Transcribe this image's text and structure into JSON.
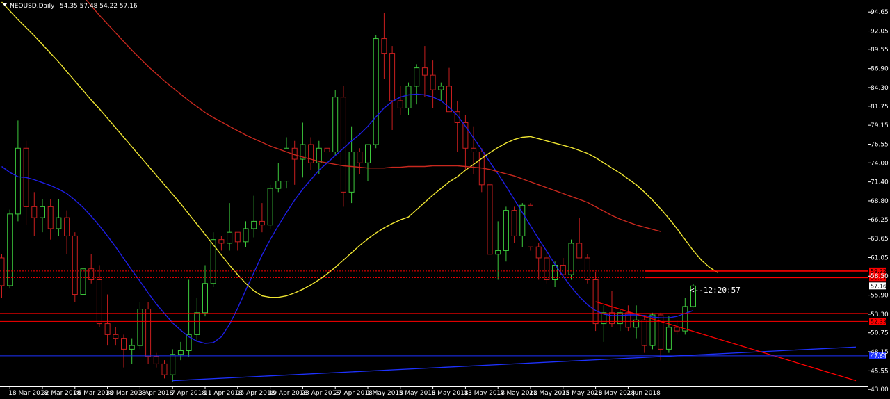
{
  "header": {
    "symbol": "NEOUSD,Daily",
    "ohlc": "54.35 57.48 54.22 57.16"
  },
  "countdown": "<--12:20:57",
  "colors": {
    "background": "#000000",
    "bull": "#3cc83c",
    "bear": "#c81e1e",
    "ma_fast": "#1e1ee6",
    "ma_mid": "#f0e632",
    "ma_slow": "#c8281e",
    "level": "#ff0000",
    "trend_support": "#1e32ff",
    "trend_resistance": "#ff0000",
    "price_box_text": "#000000",
    "axis_text": "#ffffff"
  },
  "chart_data": {
    "type": "candlestick",
    "ylim": [
      43.4,
      96.0
    ],
    "y_ticks": [
      "94.65",
      "92.05",
      "89.55",
      "86.90",
      "84.30",
      "81.75",
      "79.15",
      "76.55",
      "74.00",
      "71.40",
      "68.80",
      "66.25",
      "63.65",
      "61.05",
      "58.50",
      "55.90",
      "53.30",
      "50.75",
      "48.15",
      "45.55",
      "43.00"
    ],
    "x_ticks": [
      "18 Mar 2018",
      "22 Mar 2018",
      "26 Mar 2018",
      "30 Mar 2018",
      "3 Apr 2018",
      "7 Apr 2018",
      "11 Apr 2018",
      "15 Apr 2018",
      "19 Apr 2018",
      "23 Apr 2018",
      "27 Apr 2018",
      "1 May 2018",
      "5 May 2018",
      "9 May 2018",
      "13 May 2018",
      "17 May 2018",
      "21 May 2018",
      "25 May 2018",
      "29 May 2018",
      "2 Jun 2018"
    ],
    "first_date": "17 Mar 2018",
    "last_price": 57.16,
    "candles": [
      [
        61.0,
        61.5,
        55.5,
        57.2
      ],
      [
        57.2,
        67.6,
        56.8,
        67.0
      ],
      [
        67.0,
        79.8,
        66.0,
        76.0
      ],
      [
        76.0,
        77.0,
        65.5,
        68.0
      ],
      [
        68.0,
        70.0,
        64.0,
        66.5
      ],
      [
        66.5,
        69.0,
        64.5,
        68.0
      ],
      [
        68.0,
        69.0,
        63.5,
        65.0
      ],
      [
        65.0,
        69.0,
        64.0,
        66.5
      ],
      [
        66.5,
        67.5,
        61.5,
        64.0
      ],
      [
        64.0,
        64.5,
        55.0,
        56.0
      ],
      [
        56.0,
        61.5,
        52.0,
        59.5
      ],
      [
        59.5,
        61.5,
        57.5,
        58.0
      ],
      [
        58.0,
        60.0,
        51.5,
        52.0
      ],
      [
        52.0,
        56.0,
        49.0,
        50.5
      ],
      [
        50.5,
        51.5,
        49.0,
        50.0
      ],
      [
        50.0,
        50.5,
        46.0,
        48.5
      ],
      [
        48.5,
        50.0,
        46.5,
        49.0
      ],
      [
        49.0,
        55.0,
        48.5,
        54.0
      ],
      [
        54.0,
        55.0,
        46.5,
        47.5
      ],
      [
        47.5,
        48.0,
        46.0,
        46.5
      ],
      [
        46.5,
        47.0,
        44.5,
        45.0
      ],
      [
        45.0,
        48.5,
        44.0,
        47.8
      ],
      [
        47.8,
        49.5,
        47.0,
        48.3
      ],
      [
        48.3,
        58.0,
        47.5,
        50.5
      ],
      [
        50.5,
        55.5,
        49.5,
        53.5
      ],
      [
        53.5,
        60.0,
        53.0,
        57.5
      ],
      [
        57.5,
        64.5,
        57.0,
        63.5
      ],
      [
        63.5,
        64.0,
        62.0,
        63.0
      ],
      [
        63.0,
        68.5,
        62.0,
        64.5
      ],
      [
        64.5,
        64.5,
        62.0,
        63.2
      ],
      [
        63.2,
        66.0,
        62.5,
        65.0
      ],
      [
        65.0,
        69.5,
        63.8,
        66.0
      ],
      [
        66.0,
        68.5,
        64.5,
        65.5
      ],
      [
        65.5,
        71.0,
        65.0,
        70.5
      ],
      [
        70.5,
        74.0,
        70.0,
        71.5
      ],
      [
        71.5,
        77.5,
        70.5,
        76.0
      ],
      [
        76.0,
        77.0,
        71.0,
        74.5
      ],
      [
        74.5,
        79.5,
        72.0,
        76.5
      ],
      [
        76.5,
        77.5,
        73.0,
        74.0
      ],
      [
        74.0,
        77.0,
        72.5,
        76.0
      ],
      [
        76.0,
        77.5,
        75.0,
        75.5
      ],
      [
        75.5,
        84.0,
        75.0,
        83.0
      ],
      [
        83.0,
        84.5,
        68.0,
        70.0
      ],
      [
        70.0,
        79.0,
        68.5,
        75.5
      ],
      [
        75.5,
        76.0,
        72.5,
        74.0
      ],
      [
        74.0,
        76.5,
        71.5,
        76.5
      ],
      [
        76.5,
        91.5,
        76.0,
        91.0
      ],
      [
        91.0,
        94.5,
        85.5,
        89.0
      ],
      [
        89.0,
        90.0,
        78.5,
        82.5
      ],
      [
        82.5,
        84.5,
        80.5,
        81.5
      ],
      [
        81.5,
        85.0,
        80.5,
        84.5
      ],
      [
        84.5,
        87.5,
        82.0,
        87.0
      ],
      [
        87.0,
        90.0,
        83.0,
        86.0
      ],
      [
        86.0,
        88.0,
        81.5,
        84.0
      ],
      [
        84.0,
        85.0,
        82.5,
        84.5
      ],
      [
        84.5,
        87.0,
        81.0,
        81.0
      ],
      [
        81.0,
        82.5,
        75.5,
        79.5
      ],
      [
        79.5,
        80.5,
        73.0,
        76.0
      ],
      [
        76.0,
        79.0,
        72.5,
        75.5
      ],
      [
        75.5,
        76.0,
        70.0,
        71.0
      ],
      [
        71.0,
        71.5,
        58.5,
        61.5
      ],
      [
        61.5,
        66.0,
        58.0,
        62.0
      ],
      [
        62.0,
        68.0,
        60.5,
        67.5
      ],
      [
        67.5,
        68.0,
        63.0,
        64.0
      ],
      [
        64.0,
        68.5,
        62.5,
        68.2
      ],
      [
        68.2,
        68.5,
        62.0,
        62.5
      ],
      [
        62.5,
        63.0,
        58.0,
        61.0
      ],
      [
        61.0,
        62.0,
        57.5,
        58.0
      ],
      [
        58.0,
        60.5,
        57.0,
        60.0
      ],
      [
        60.0,
        61.0,
        58.5,
        58.7
      ],
      [
        58.7,
        63.5,
        58.0,
        63.0
      ],
      [
        63.0,
        66.5,
        61.0,
        61.0
      ],
      [
        61.0,
        61.5,
        57.5,
        58.0
      ],
      [
        58.0,
        59.0,
        51.0,
        52.0
      ],
      [
        52.0,
        54.5,
        49.5,
        53.5
      ],
      [
        53.5,
        56.5,
        51.5,
        52.0
      ],
      [
        52.0,
        54.0,
        51.0,
        53.5
      ],
      [
        53.5,
        54.5,
        51.0,
        51.5
      ],
      [
        51.5,
        54.5,
        50.0,
        52.5
      ],
      [
        52.5,
        53.0,
        48.0,
        49.0
      ],
      [
        49.0,
        53.5,
        48.5,
        53.2
      ],
      [
        53.2,
        53.5,
        47.0,
        48.5
      ],
      [
        48.5,
        53.0,
        48.0,
        51.5
      ],
      [
        51.5,
        52.5,
        50.5,
        51.0
      ],
      [
        51.0,
        55.5,
        50.5,
        54.35
      ],
      [
        54.35,
        57.48,
        54.22,
        57.16
      ]
    ],
    "series": [
      {
        "name": "",
        "period": "fast",
        "values": [
          73.5,
          72.7,
          72.1,
          72.0,
          71.7,
          71.3,
          70.9,
          70.4,
          69.8,
          68.9,
          67.9,
          66.7,
          65.4,
          64.0,
          62.5,
          60.9,
          59.3,
          57.8,
          56.2,
          54.7,
          53.4,
          52.1,
          51.1,
          50.2,
          49.6,
          49.3,
          49.4,
          50.2,
          51.9,
          54.1,
          56.6,
          59.0,
          61.4,
          63.5,
          65.4,
          67.2,
          68.9,
          70.4,
          71.7,
          73.0,
          74.0,
          75.0,
          76.0,
          77.0,
          77.9,
          79.0,
          80.3,
          81.5,
          82.4,
          83.0,
          83.3,
          83.4,
          83.3,
          83.0,
          82.5,
          81.6,
          80.5,
          79.0,
          77.4,
          75.8,
          74.1,
          72.5,
          70.8,
          69.0,
          67.2,
          65.4,
          63.6,
          61.9,
          60.1,
          58.5,
          57.0,
          55.7,
          54.6,
          53.8,
          53.3,
          53.1,
          53.1,
          53.2,
          53.2,
          53.1,
          52.9,
          52.8,
          52.8,
          53.0,
          53.4,
          53.8
        ]
      },
      {
        "name": "",
        "period": "mid",
        "values": [
          96.0,
          94.8,
          93.6,
          92.5,
          91.4,
          90.2,
          89.0,
          87.8,
          86.5,
          85.2,
          83.9,
          82.6,
          81.4,
          80.1,
          78.8,
          77.5,
          76.2,
          74.9,
          73.6,
          72.3,
          71.0,
          69.7,
          68.4,
          67.0,
          65.6,
          64.2,
          62.8,
          61.4,
          60.0,
          58.7,
          57.5,
          56.5,
          55.8,
          55.6,
          55.6,
          55.8,
          56.2,
          56.7,
          57.3,
          58.0,
          58.8,
          59.7,
          60.7,
          61.7,
          62.7,
          63.6,
          64.4,
          65.1,
          65.7,
          66.2,
          66.6,
          67.6,
          68.6,
          69.6,
          70.5,
          71.4,
          72.1,
          73.0,
          73.8,
          74.6,
          75.4,
          76.1,
          76.7,
          77.2,
          77.5,
          77.6,
          77.3,
          77.0,
          76.7,
          76.4,
          76.1,
          75.7,
          75.3,
          74.7,
          74.0,
          73.3,
          72.6,
          71.8,
          71.0,
          70.0,
          68.9,
          67.7,
          66.4,
          65.0,
          63.5,
          62.0,
          60.7,
          59.7,
          59.0
        ]
      },
      {
        "name": "",
        "period": "slow",
        "values": [
          111.0,
          109.5,
          108.0,
          106.5,
          105.0,
          103.6,
          102.2,
          100.8,
          99.4,
          98.1,
          96.8,
          95.5,
          94.2,
          93.0,
          91.8,
          90.6,
          89.4,
          88.3,
          87.2,
          86.2,
          85.2,
          84.3,
          83.4,
          82.5,
          81.7,
          80.9,
          80.2,
          79.6,
          79.0,
          78.4,
          77.8,
          77.3,
          76.8,
          76.3,
          75.9,
          75.5,
          75.1,
          74.8,
          74.5,
          74.2,
          74.0,
          73.8,
          73.6,
          73.5,
          73.4,
          73.3,
          73.3,
          73.3,
          73.4,
          73.4,
          73.5,
          73.5,
          73.5,
          73.6,
          73.6,
          73.6,
          73.6,
          73.5,
          73.4,
          73.3,
          73.1,
          72.8,
          72.5,
          72.2,
          71.8,
          71.4,
          71.0,
          70.6,
          70.2,
          69.8,
          69.4,
          69.0,
          68.6,
          68.0,
          67.4,
          66.8,
          66.3,
          65.9,
          65.5,
          65.2,
          64.9,
          64.6
        ]
      }
    ],
    "levels": [
      {
        "price": 59.2,
        "style": "dotted",
        "label": "59.22"
      },
      {
        "price": 58.3,
        "style": "dotted",
        "label": "58.37"
      },
      {
        "price": 53.4,
        "style": "solid",
        "label": ""
      },
      {
        "price": 52.3,
        "style": "solid",
        "label": "52.33"
      },
      {
        "price": 47.6,
        "style": "solid-blue",
        "label": "47.64"
      }
    ],
    "trendlines": [
      {
        "kind": "support",
        "from": [
          21,
          44.2
        ],
        "to": [
          105,
          48.8
        ]
      },
      {
        "kind": "resistance",
        "from": [
          73,
          55.0
        ],
        "to": [
          105,
          44.2
        ]
      }
    ]
  }
}
